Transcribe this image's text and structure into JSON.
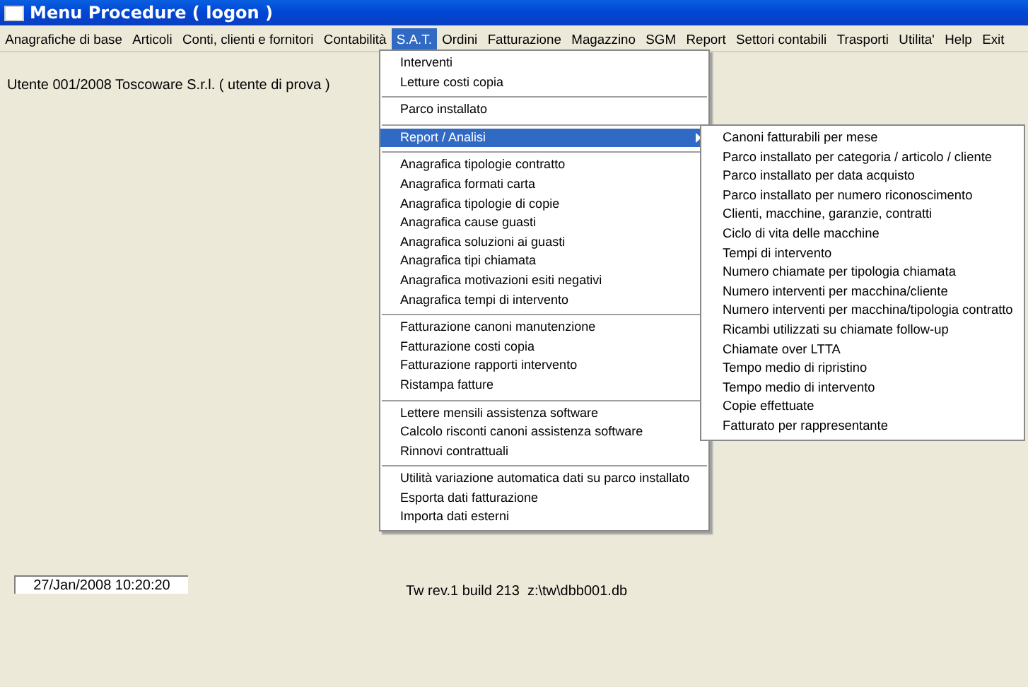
{
  "window": {
    "title": "Menu Procedure ( logon )"
  },
  "menu_bar": [
    {
      "label": "Anagrafiche di base",
      "selected": false
    },
    {
      "label": "Articoli",
      "selected": false
    },
    {
      "label": "Conti, clienti e fornitori",
      "selected": false
    },
    {
      "label": "Contabilità",
      "selected": false
    },
    {
      "label": "S.A.T.",
      "selected": true
    },
    {
      "label": "Ordini",
      "selected": false
    },
    {
      "label": "Fatturazione",
      "selected": false
    },
    {
      "label": "Magazzino",
      "selected": false
    },
    {
      "label": "SGM",
      "selected": false
    },
    {
      "label": "Report",
      "selected": false
    },
    {
      "label": "Settori contabili",
      "selected": false
    },
    {
      "label": "Trasporti",
      "selected": false
    },
    {
      "label": "Utilita'",
      "selected": false
    },
    {
      "label": "Help",
      "selected": false
    },
    {
      "label": "Exit",
      "selected": false
    }
  ],
  "user_line": "Utente 001/2008 Toscoware S.r.l. ( utente di prova )",
  "dropdown": {
    "groups": [
      [
        {
          "label": "Interventi",
          "selected": false,
          "has_submenu": false
        },
        {
          "label": "Letture costi copia",
          "selected": false,
          "has_submenu": false
        }
      ],
      [
        {
          "label": "Parco installato",
          "selected": false,
          "has_submenu": false
        }
      ],
      [
        {
          "label": "Report / Analisi",
          "selected": true,
          "has_submenu": true
        }
      ],
      [
        {
          "label": "Anagrafica tipologie contratto",
          "selected": false,
          "has_submenu": false
        },
        {
          "label": "Anagrafica formati carta",
          "selected": false,
          "has_submenu": false
        },
        {
          "label": "Anagrafica tipologie di copie",
          "selected": false,
          "has_submenu": false
        },
        {
          "label": "Anagrafica cause guasti",
          "selected": false,
          "has_submenu": false
        },
        {
          "label": "Anagrafica soluzioni ai guasti",
          "selected": false,
          "has_submenu": false
        },
        {
          "label": "Anagrafica tipi chiamata",
          "selected": false,
          "has_submenu": false
        },
        {
          "label": "Anagrafica motivazioni esiti negativi",
          "selected": false,
          "has_submenu": false
        },
        {
          "label": "Anagrafica tempi di intervento",
          "selected": false,
          "has_submenu": false
        }
      ],
      [
        {
          "label": "Fatturazione canoni manutenzione",
          "selected": false,
          "has_submenu": false
        },
        {
          "label": "Fatturazione costi copia",
          "selected": false,
          "has_submenu": false
        },
        {
          "label": "Fatturazione rapporti intervento",
          "selected": false,
          "has_submenu": false
        },
        {
          "label": "Ristampa fatture",
          "selected": false,
          "has_submenu": false
        }
      ],
      [
        {
          "label": "Lettere mensili assistenza software",
          "selected": false,
          "has_submenu": false
        },
        {
          "label": "Calcolo risconti canoni assistenza software",
          "selected": false,
          "has_submenu": false
        },
        {
          "label": "Rinnovi contrattuali",
          "selected": false,
          "has_submenu": false
        }
      ],
      [
        {
          "label": "Utilità variazione automatica dati su parco installato",
          "selected": false,
          "has_submenu": false
        },
        {
          "label": "Esporta dati fatturazione",
          "selected": false,
          "has_submenu": false
        },
        {
          "label": "Importa dati esterni",
          "selected": false,
          "has_submenu": false
        }
      ]
    ]
  },
  "submenu": [
    "Canoni fatturabili per mese",
    "Parco installato per categoria / articolo / cliente",
    "Parco installato per data acquisto",
    "Parco installato per numero riconoscimento",
    "Clienti, macchine, garanzie, contratti",
    "Ciclo di vita delle macchine",
    "Tempi di intervento",
    "Numero chiamate per tipologia chiamata",
    "Numero interventi per macchina/cliente",
    "Numero interventi per macchina/tipologia contratto",
    "Ricambi utilizzati su chiamate follow-up",
    "Chiamate over LTTA",
    "Tempo medio di ripristino",
    "Tempo medio di intervento",
    "Copie effettuate",
    "Fatturato per rappresentante"
  ],
  "status": {
    "datetime": "27/Jan/2008 10:20:20",
    "version": "Tw rev.1 build 213  z:\\tw\\dbb001.db"
  }
}
